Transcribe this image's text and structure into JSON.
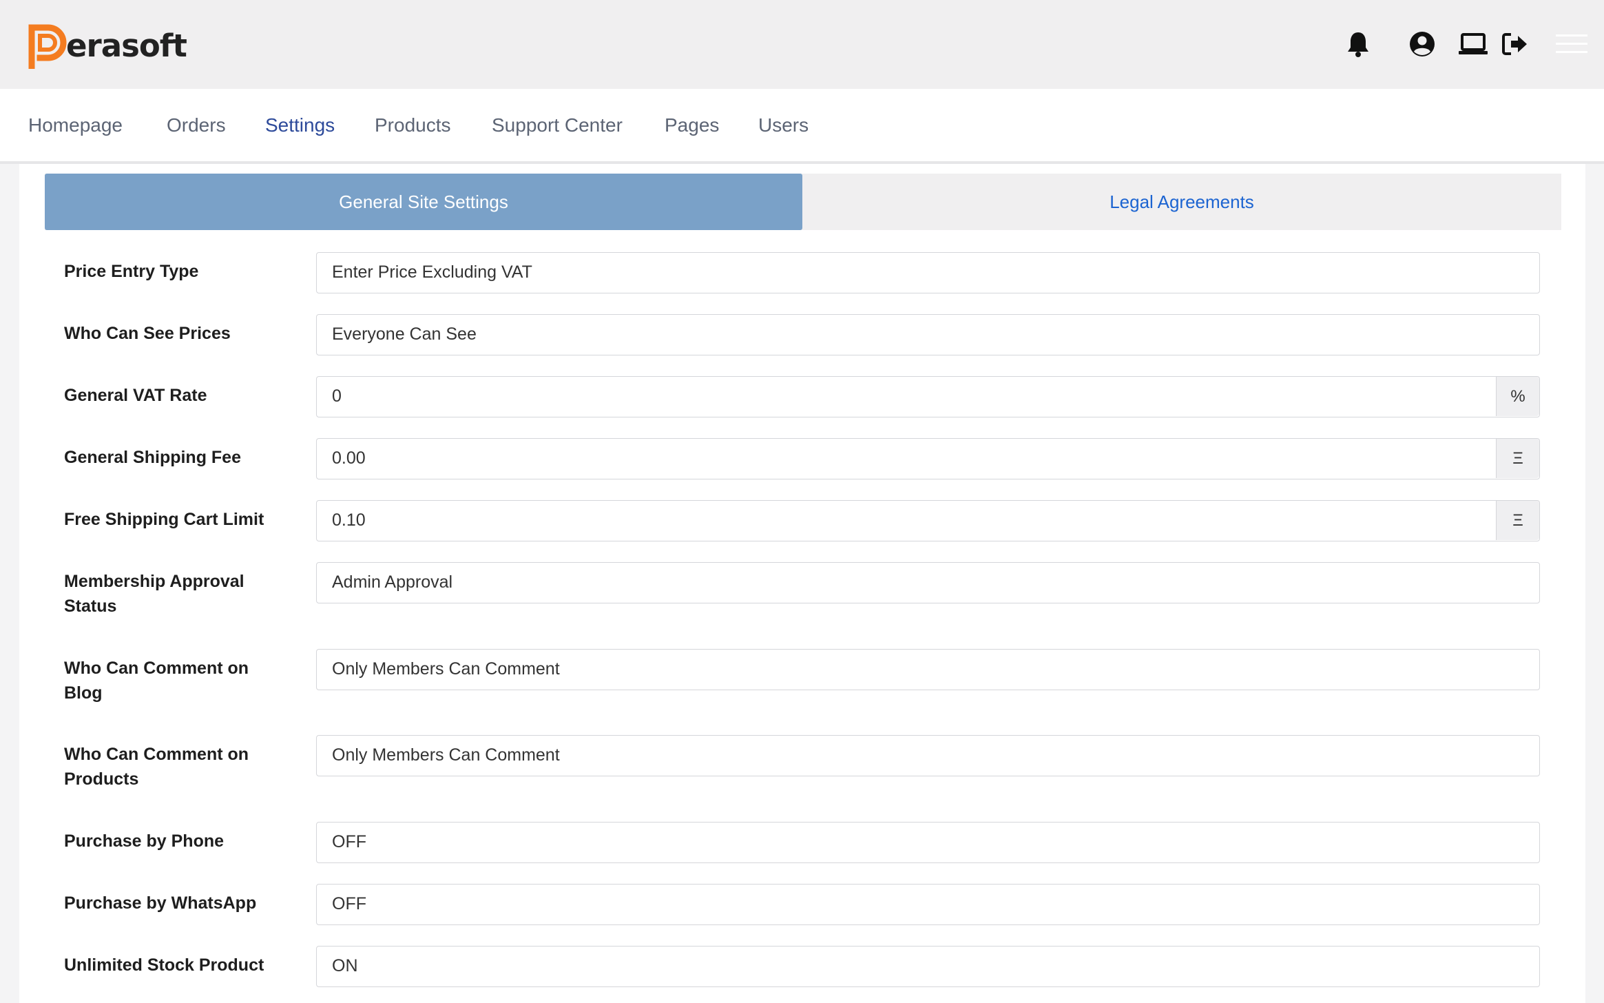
{
  "brand": {
    "logo_text": "erasoft",
    "accent_color": "#f47c20"
  },
  "topbar": {
    "icons": [
      "bell-icon",
      "user-circle-icon",
      "laptop-icon",
      "logout-icon",
      "hamburger-menu-icon"
    ]
  },
  "nav": {
    "items": [
      {
        "label": "Homepage",
        "active": false
      },
      {
        "label": "Orders",
        "active": false
      },
      {
        "label": "Settings",
        "active": true
      },
      {
        "label": "Products",
        "active": false
      },
      {
        "label": "Support Center",
        "active": false
      },
      {
        "label": "Pages",
        "active": false
      },
      {
        "label": "Users",
        "active": false
      }
    ]
  },
  "tabs": {
    "general": "General Site Settings",
    "legal": "Legal Agreements"
  },
  "settings": [
    {
      "label": "Price Entry Type",
      "value": "Enter Price Excluding VAT"
    },
    {
      "label": "Who Can See Prices",
      "value": "Everyone Can See"
    },
    {
      "label": "General VAT Rate",
      "value": "0",
      "addon": "%"
    },
    {
      "label": "General Shipping Fee",
      "value": "0.00",
      "addon": "Ξ"
    },
    {
      "label": "Free Shipping Cart Limit",
      "value": "0.10",
      "addon": "Ξ"
    },
    {
      "label": "Membership Approval Status",
      "value": "Admin Approval"
    },
    {
      "label": "Who Can Comment on Blog",
      "value": "Only Members Can Comment"
    },
    {
      "label": "Who Can Comment on Products",
      "value": "Only Members Can Comment"
    },
    {
      "label": "Purchase by Phone",
      "value": "OFF"
    },
    {
      "label": "Purchase by WhatsApp",
      "value": "OFF"
    },
    {
      "label": "Unlimited Stock Product",
      "value": "ON"
    }
  ]
}
